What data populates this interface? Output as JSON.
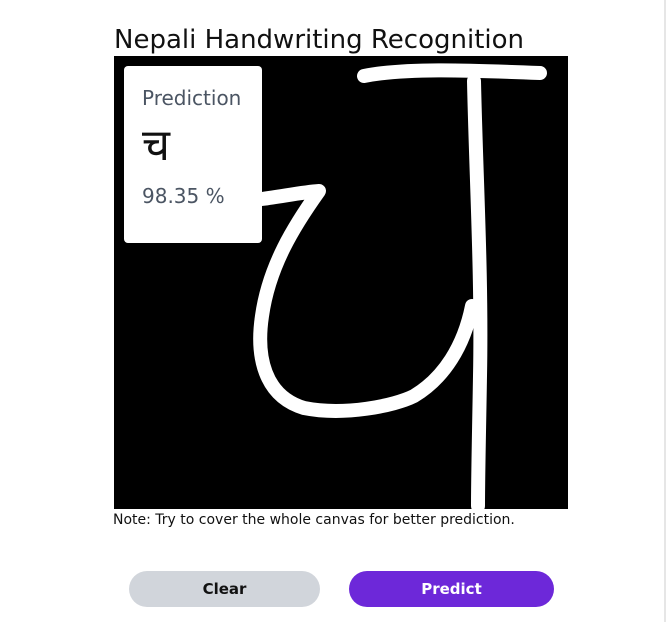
{
  "app": {
    "title": "Nepali Handwriting Recognition"
  },
  "prediction": {
    "label": "Prediction",
    "character": "च",
    "confidence": "98.35 %"
  },
  "canvas": {
    "background_color": "#000000",
    "stroke_color": "#ffffff"
  },
  "note": "Note: Try to cover the whole canvas for better prediction.",
  "buttons": {
    "clear_label": "Clear",
    "predict_label": "Predict"
  },
  "colors": {
    "accent": "#6d28d9",
    "clear_button": "#d1d5db"
  }
}
